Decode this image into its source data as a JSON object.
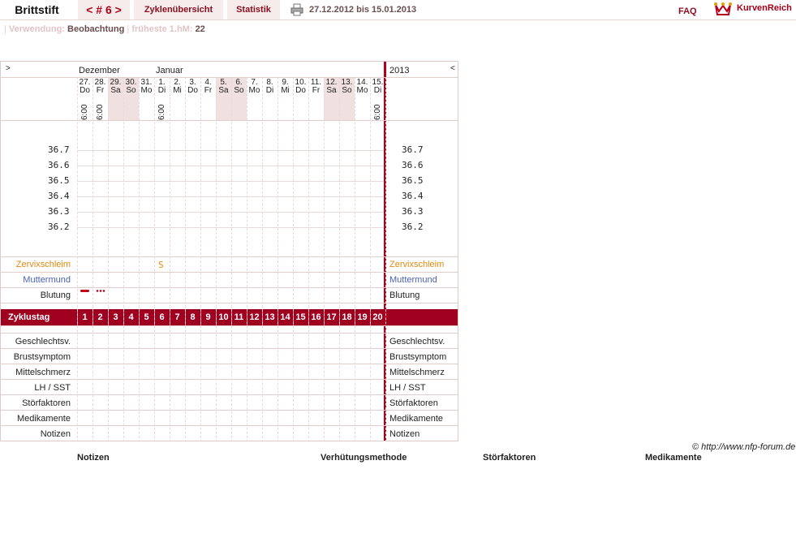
{
  "header": {
    "brand": "Brittstift",
    "cycle": "< # 6 >",
    "overview": "Zyklenübersicht",
    "stats": "Statistik",
    "date_range": "27.12.2012 bis 15.01.2013",
    "faq": "FAQ",
    "logo": "KurvenReich"
  },
  "info": {
    "sep": "|",
    "usage_label": "Verwendung:",
    "usage_value": "Beobachtung",
    "earliest_label": "früheste 1.hM:",
    "earliest_value": "22"
  },
  "chart": {
    "nav_left": ">",
    "nav_right": "<",
    "year": "2013",
    "months": [
      "Dezember",
      "Januar"
    ],
    "days": [
      {
        "num": "27.",
        "name": "Do",
        "wkend": false,
        "time": "6:00"
      },
      {
        "num": "28.",
        "name": "Fr",
        "wkend": false,
        "time": "6:00"
      },
      {
        "num": "29.",
        "name": "Sa",
        "wkend": true,
        "time": ""
      },
      {
        "num": "30.",
        "name": "So",
        "wkend": true,
        "time": ""
      },
      {
        "num": "31.",
        "name": "Mo",
        "wkend": false,
        "time": ""
      },
      {
        "num": "1.",
        "name": "Di",
        "wkend": false,
        "time": "6:00"
      },
      {
        "num": "2.",
        "name": "Mi",
        "wkend": false,
        "time": ""
      },
      {
        "num": "3.",
        "name": "Do",
        "wkend": false,
        "time": ""
      },
      {
        "num": "4.",
        "name": "Fr",
        "wkend": false,
        "time": ""
      },
      {
        "num": "5.",
        "name": "Sa",
        "wkend": true,
        "time": ""
      },
      {
        "num": "6.",
        "name": "So",
        "wkend": true,
        "time": ""
      },
      {
        "num": "7.",
        "name": "Mo",
        "wkend": false,
        "time": ""
      },
      {
        "num": "8.",
        "name": "Di",
        "wkend": false,
        "time": ""
      },
      {
        "num": "9.",
        "name": "Mi",
        "wkend": false,
        "time": ""
      },
      {
        "num": "10.",
        "name": "Do",
        "wkend": false,
        "time": ""
      },
      {
        "num": "11.",
        "name": "Fr",
        "wkend": false,
        "time": ""
      },
      {
        "num": "12.",
        "name": "Sa",
        "wkend": true,
        "time": ""
      },
      {
        "num": "13.",
        "name": "So",
        "wkend": true,
        "time": ""
      },
      {
        "num": "14.",
        "name": "Mo",
        "wkend": false,
        "time": ""
      },
      {
        "num": "15.",
        "name": "Di",
        "wkend": false,
        "time": "6:00"
      }
    ],
    "temps": [
      "36.7",
      "36.6",
      "36.5",
      "36.4",
      "36.3",
      "36.2"
    ],
    "rows_top": {
      "zervix": "Zervixschleim",
      "mutter": "Muttermund",
      "blutung": "Blutung"
    },
    "zervix_value": "S",
    "zervix_day_index": 5,
    "cycle_label": "Zyklustag",
    "cycle_days": [
      "1",
      "2",
      "3",
      "4",
      "5",
      "6",
      "7",
      "8",
      "9",
      "10",
      "11",
      "12",
      "13",
      "14",
      "15",
      "16",
      "17",
      "18",
      "19",
      "20"
    ],
    "rows_bottom": [
      "Geschlechtsv.",
      "Brustsymptom",
      "Mittelschmerz",
      "LH / SST",
      "Störfaktoren",
      "Medikamente",
      "Notizen"
    ]
  },
  "copyright": "© http://www.nfp-forum.de",
  "footer": [
    "Notizen",
    "Verhütungsmethode",
    "Störfaktoren",
    "Medikamente"
  ]
}
